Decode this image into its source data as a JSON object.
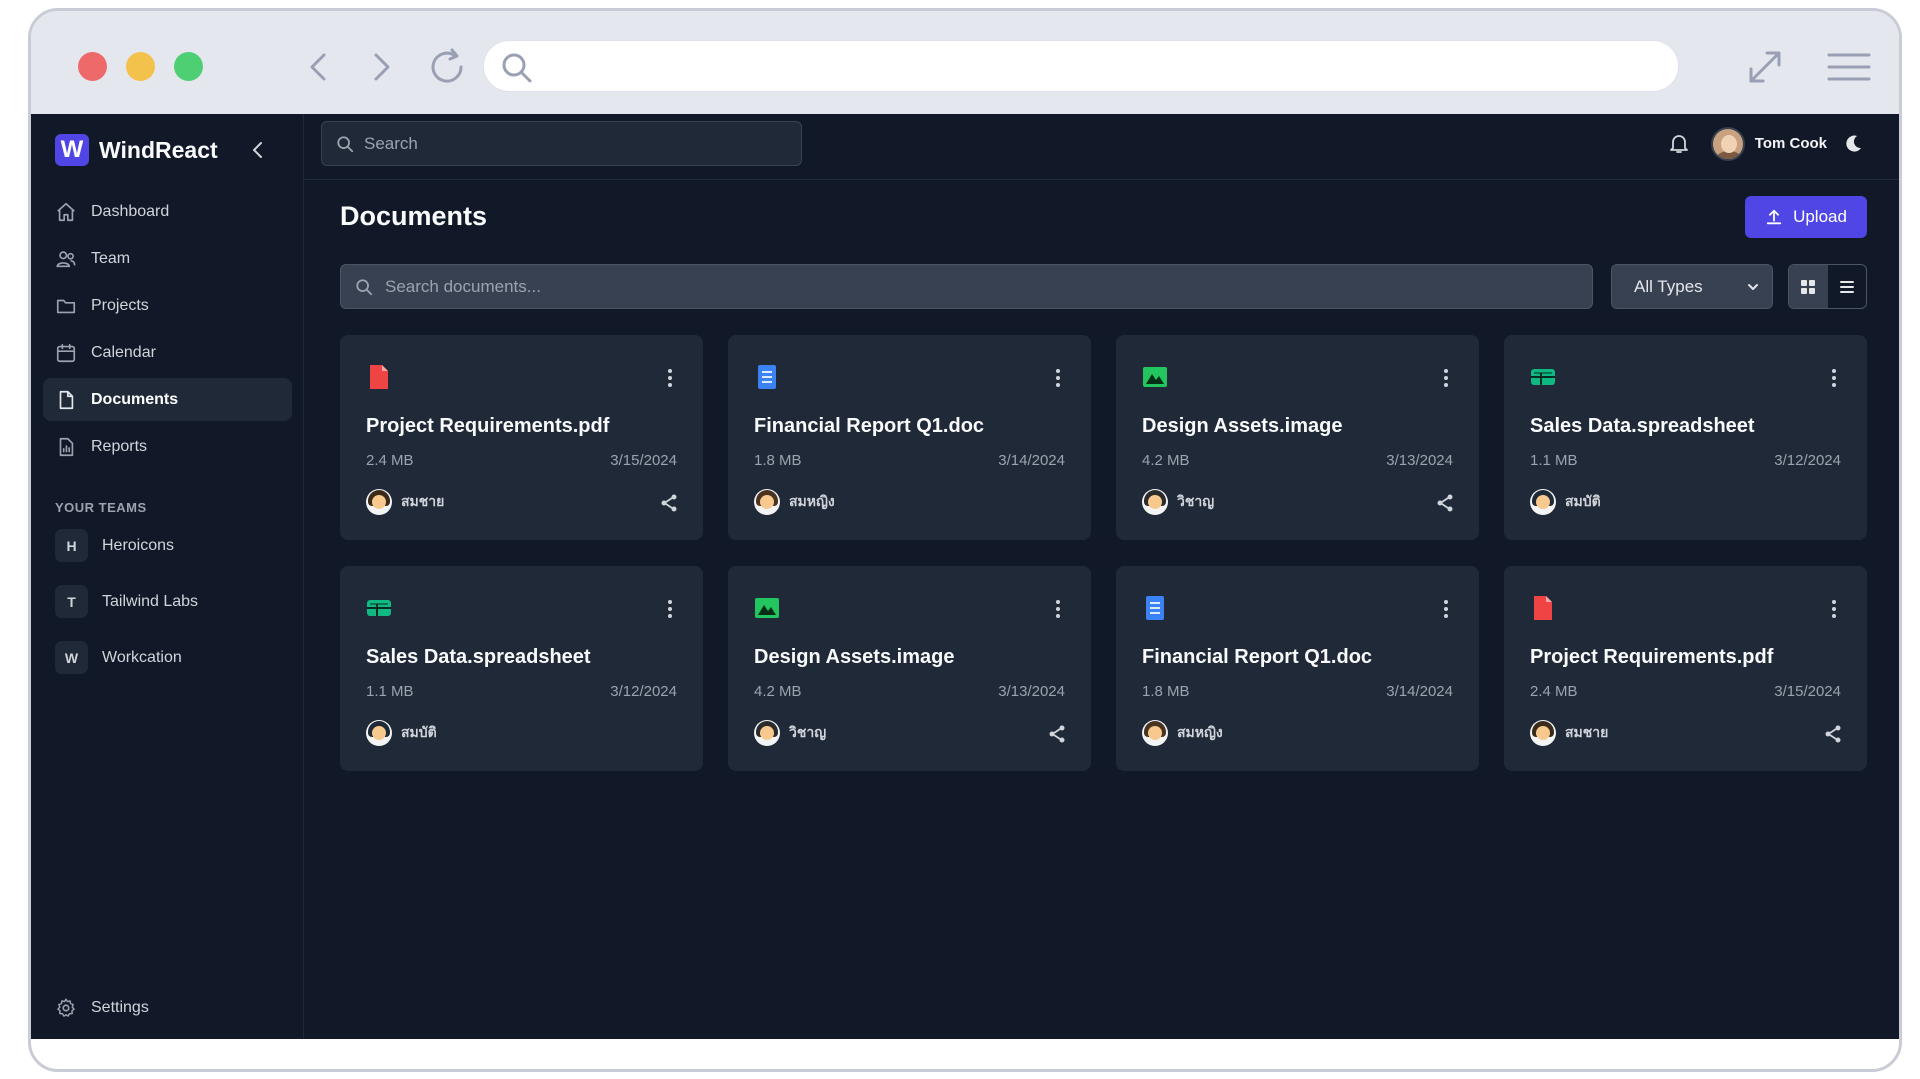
{
  "app": {
    "name": "WindReact",
    "logo_letter": "W"
  },
  "colors": {
    "accent": "#4f46e5",
    "background": "#111827",
    "card": "#1f2937",
    "pdf": "#ef4444",
    "doc": "#3b82f6",
    "image": "#22c55e",
    "spreadsheet": "#10b981"
  },
  "topbar": {
    "search_placeholder": "Search",
    "user_name": "Tom Cook"
  },
  "sidebar": {
    "items": [
      {
        "label": "Dashboard",
        "icon": "home-icon"
      },
      {
        "label": "Team",
        "icon": "users-icon"
      },
      {
        "label": "Projects",
        "icon": "folder-icon"
      },
      {
        "label": "Calendar",
        "icon": "calendar-icon"
      },
      {
        "label": "Documents",
        "icon": "document-icon",
        "active": true
      },
      {
        "label": "Reports",
        "icon": "chart-icon"
      }
    ],
    "teams_label": "YOUR TEAMS",
    "teams": [
      {
        "badge": "H",
        "label": "Heroicons"
      },
      {
        "badge": "T",
        "label": "Tailwind Labs"
      },
      {
        "badge": "W",
        "label": "Workcation"
      }
    ],
    "settings_label": "Settings"
  },
  "main": {
    "title": "Documents",
    "upload_label": "Upload",
    "search_placeholder": "Search documents...",
    "filter_value": "All Types"
  },
  "documents": [
    {
      "name": "Project Requirements.pdf",
      "type": "pdf",
      "size": "2.4 MB",
      "date": "3/15/2024",
      "owner": "สมชาย",
      "shared": true
    },
    {
      "name": "Financial Report Q1.doc",
      "type": "doc",
      "size": "1.8 MB",
      "date": "3/14/2024",
      "owner": "สมหญิง",
      "shared": false
    },
    {
      "name": "Design Assets.image",
      "type": "image",
      "size": "4.2 MB",
      "date": "3/13/2024",
      "owner": "วิชาญ",
      "shared": true
    },
    {
      "name": "Sales Data.spreadsheet",
      "type": "spreadsheet",
      "size": "1.1 MB",
      "date": "3/12/2024",
      "owner": "สมบัติ",
      "shared": false
    },
    {
      "name": "Sales Data.spreadsheet",
      "type": "spreadsheet",
      "size": "1.1 MB",
      "date": "3/12/2024",
      "owner": "สมบัติ",
      "shared": false
    },
    {
      "name": "Design Assets.image",
      "type": "image",
      "size": "4.2 MB",
      "date": "3/13/2024",
      "owner": "วิชาญ",
      "shared": true
    },
    {
      "name": "Financial Report Q1.doc",
      "type": "doc",
      "size": "1.8 MB",
      "date": "3/14/2024",
      "owner": "สมหญิง",
      "shared": false
    },
    {
      "name": "Project Requirements.pdf",
      "type": "pdf",
      "size": "2.4 MB",
      "date": "3/15/2024",
      "owner": "สมชาย",
      "shared": true
    }
  ]
}
